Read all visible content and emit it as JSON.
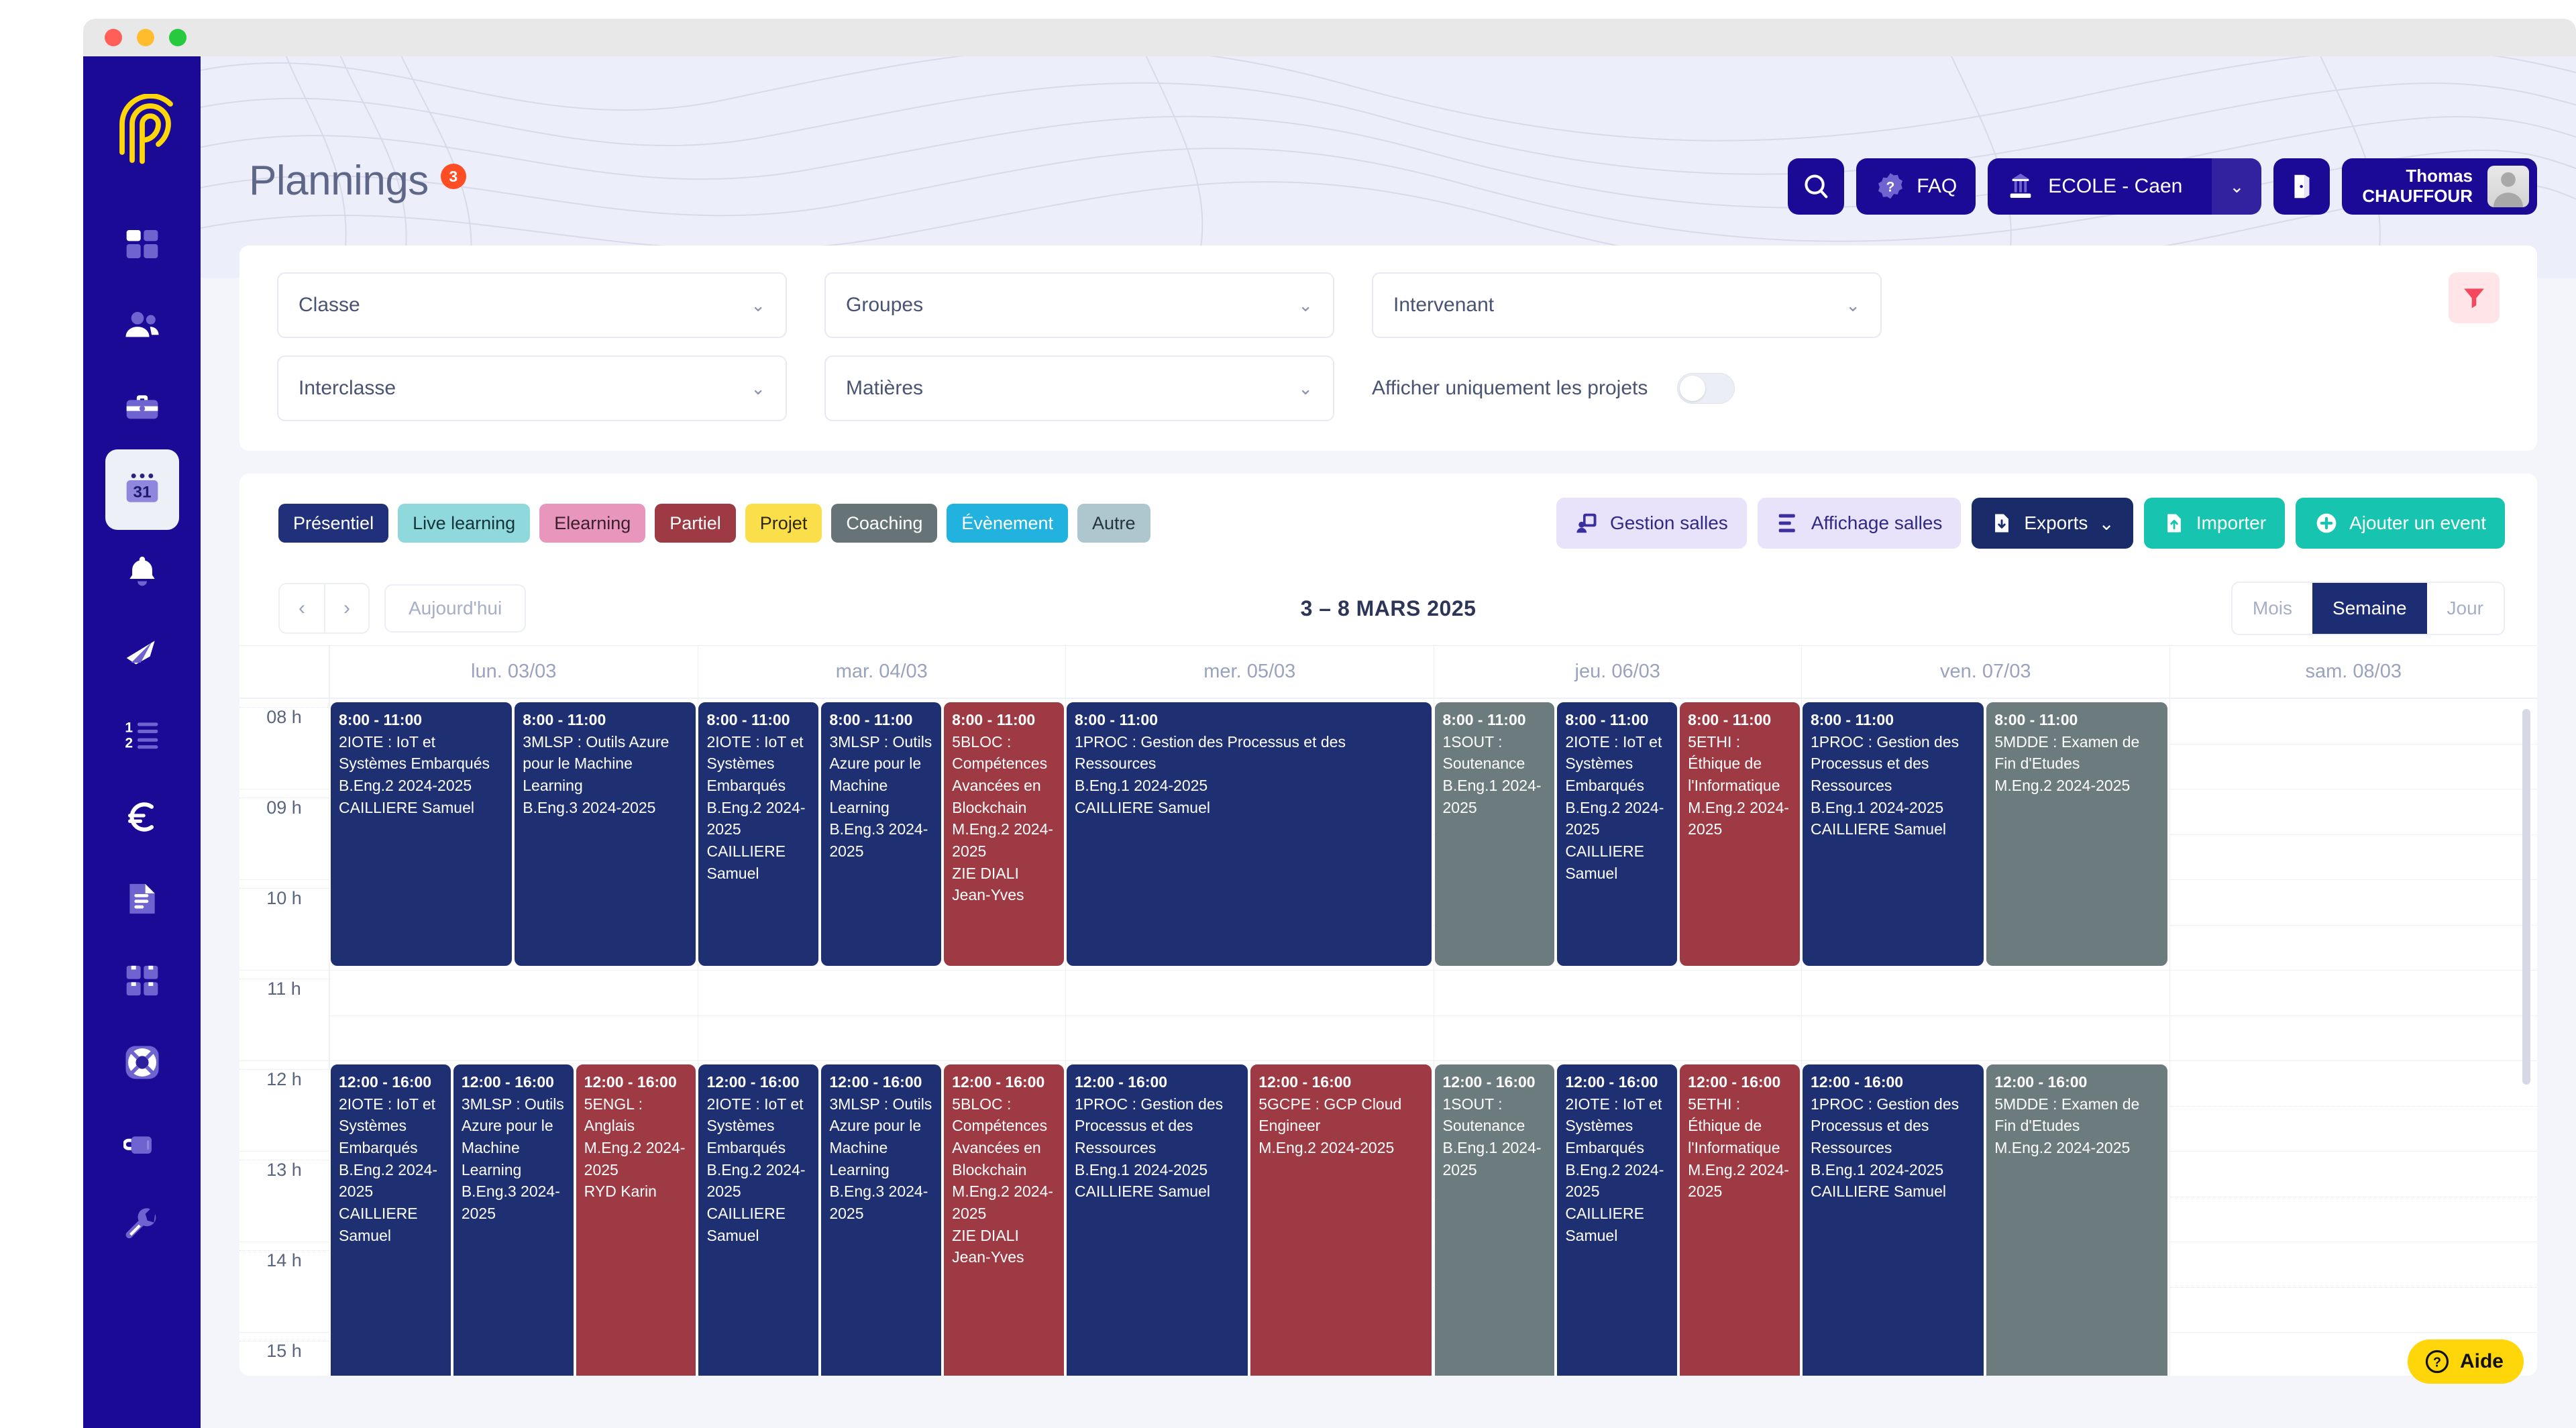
{
  "window": {
    "dots": [
      "close",
      "minimize",
      "maximize"
    ]
  },
  "sidebar": {
    "logo_name": "company-logo",
    "items": [
      {
        "name": "dashboard",
        "icon": "grid-icon",
        "active": false
      },
      {
        "name": "students",
        "icon": "users-icon",
        "active": false
      },
      {
        "name": "companies",
        "icon": "briefcase-icon",
        "active": false
      },
      {
        "name": "plannings",
        "icon": "calendar-31-icon",
        "active": true
      },
      {
        "name": "notifications",
        "icon": "bell-icon",
        "active": false
      },
      {
        "name": "campaigns",
        "icon": "rocket-icon",
        "active": false
      },
      {
        "name": "ranking",
        "icon": "ordered-list-icon",
        "active": false
      },
      {
        "name": "finance",
        "icon": "euro-icon",
        "active": false
      },
      {
        "name": "documents",
        "icon": "document-icon",
        "active": false
      },
      {
        "name": "modules",
        "icon": "boxes-icon",
        "active": false
      },
      {
        "name": "support",
        "icon": "lifebuoy-icon",
        "active": false
      },
      {
        "name": "coffee",
        "icon": "mug-icon",
        "active": false
      },
      {
        "name": "settings",
        "icon": "wrench-icon",
        "active": false
      }
    ]
  },
  "header": {
    "title": "Plannings",
    "badge": "3",
    "search_icon": "search-icon",
    "faq_label": "FAQ",
    "school_label": "ECOLE - Caen",
    "school_caret": "⌄",
    "logout_icon": "logout-icon",
    "user_first_name": "Thomas",
    "user_last_name": "CHAUFFOUR"
  },
  "filters": {
    "classe": "Classe",
    "groupes": "Groupes",
    "intervenant": "Intervenant",
    "interclasse": "Interclasse",
    "matieres": "Matières",
    "projects_toggle_label": "Afficher uniquement les projets",
    "projects_toggle_on": false,
    "filter_button": "filter-icon"
  },
  "legend": [
    {
      "label": "Présentiel",
      "bg": "#21307b",
      "fg": "#ffffff"
    },
    {
      "label": "Live learning",
      "bg": "#8fd9dd",
      "fg": "#15333a"
    },
    {
      "label": "Elearning",
      "bg": "#e996bd",
      "fg": "#3a1f2c"
    },
    {
      "label": "Partiel",
      "bg": "#9d3a44",
      "fg": "#ffffff"
    },
    {
      "label": "Projet",
      "bg": "#fbdf4a",
      "fg": "#2c2700"
    },
    {
      "label": "Coaching",
      "bg": "#667377",
      "fg": "#ffffff"
    },
    {
      "label": "Évènement",
      "bg": "#22b2e0",
      "fg": "#ffffff"
    },
    {
      "label": "Autre",
      "bg": "#aec7cf",
      "fg": "#23343a"
    }
  ],
  "actions": {
    "gestion_salles": "Gestion salles",
    "affichage_salles": "Affichage salles",
    "exports": "Exports",
    "exports_caret": "⌄",
    "importer": "Importer",
    "ajouter": "Ajouter un event"
  },
  "calendar": {
    "prev": "‹",
    "next": "›",
    "today": "Aujourd'hui",
    "range": "3 – 8 MARS 2025",
    "views": [
      {
        "label": "Mois",
        "active": false
      },
      {
        "label": "Semaine",
        "active": true
      },
      {
        "label": "Jour",
        "active": false
      }
    ],
    "days": [
      "lun. 03/03",
      "mar. 04/03",
      "mer. 05/03",
      "jeu. 06/03",
      "ven. 07/03",
      "sam. 08/03"
    ],
    "hours": [
      "08 h",
      "09 h",
      "10 h",
      "11 h",
      "12 h",
      "13 h",
      "14 h",
      "15 h"
    ],
    "events": [
      {
        "day": 0,
        "lane": 0,
        "lanes": 2,
        "start": 8,
        "end": 11,
        "color": "ev-navy",
        "time": "8:00 - 11:00",
        "title": "2IOTE : IoT et Systèmes Embarqués",
        "meta1": "B.Eng.2 2024-2025",
        "meta2": "CAILLIERE Samuel"
      },
      {
        "day": 0,
        "lane": 1,
        "lanes": 2,
        "start": 8,
        "end": 11,
        "color": "ev-navy",
        "time": "8:00 - 11:00",
        "title": "3MLSP : Outils Azure pour le Machine Learning",
        "meta1": "B.Eng.3 2024-2025",
        "meta2": ""
      },
      {
        "day": 1,
        "lane": 0,
        "lanes": 3,
        "start": 8,
        "end": 11,
        "color": "ev-navy",
        "time": "8:00 - 11:00",
        "title": "2IOTE : IoT et Systèmes Embarqués",
        "meta1": "B.Eng.2 2024-2025",
        "meta2": "CAILLIERE Samuel"
      },
      {
        "day": 1,
        "lane": 1,
        "lanes": 3,
        "start": 8,
        "end": 11,
        "color": "ev-navy",
        "time": "8:00 - 11:00",
        "title": "3MLSP : Outils Azure pour le Machine Learning",
        "meta1": "B.Eng.3 2024-2025",
        "meta2": ""
      },
      {
        "day": 1,
        "lane": 2,
        "lanes": 3,
        "start": 8,
        "end": 11,
        "color": "ev-red",
        "time": "8:00 - 11:00",
        "title": "5BLOC : Compétences Avancées en Blockchain",
        "meta1": "M.Eng.2 2024-2025",
        "meta2": "ZIE DIALI Jean-Yves"
      },
      {
        "day": 2,
        "lane": 0,
        "lanes": 1,
        "start": 8,
        "end": 11,
        "color": "ev-navy",
        "time": "8:00 - 11:00",
        "title": "1PROC : Gestion des Processus et des Ressources",
        "meta1": "B.Eng.1 2024-2025",
        "meta2": "CAILLIERE Samuel"
      },
      {
        "day": 3,
        "lane": 0,
        "lanes": 3,
        "start": 8,
        "end": 11,
        "color": "ev-grey",
        "time": "8:00 - 11:00",
        "title": "1SOUT : Soutenance",
        "meta1": "B.Eng.1 2024-2025",
        "meta2": ""
      },
      {
        "day": 3,
        "lane": 1,
        "lanes": 3,
        "start": 8,
        "end": 11,
        "color": "ev-navy",
        "time": "8:00 - 11:00",
        "title": "2IOTE : IoT et Systèmes Embarqués",
        "meta1": "B.Eng.2 2024-2025",
        "meta2": "CAILLIERE Samuel"
      },
      {
        "day": 3,
        "lane": 2,
        "lanes": 3,
        "start": 8,
        "end": 11,
        "color": "ev-red",
        "time": "8:00 - 11:00",
        "title": "5ETHI : Éthique de l'Informatique",
        "meta1": "M.Eng.2 2024-2025",
        "meta2": ""
      },
      {
        "day": 4,
        "lane": 0,
        "lanes": 2,
        "start": 8,
        "end": 11,
        "color": "ev-navy",
        "time": "8:00 - 11:00",
        "title": "1PROC : Gestion des Processus et des Ressources",
        "meta1": "B.Eng.1 2024-2025",
        "meta2": "CAILLIERE Samuel"
      },
      {
        "day": 4,
        "lane": 1,
        "lanes": 2,
        "start": 8,
        "end": 11,
        "color": "ev-grey",
        "time": "8:00 - 11:00",
        "title": "5MDDE : Examen de Fin d'Etudes",
        "meta1": "M.Eng.2 2024-2025",
        "meta2": ""
      },
      {
        "day": 0,
        "lane": 0,
        "lanes": 3,
        "start": 12,
        "end": 16,
        "color": "ev-navy",
        "time": "12:00 - 16:00",
        "title": "2IOTE : IoT et Systèmes Embarqués",
        "meta1": "B.Eng.2 2024-2025",
        "meta2": "CAILLIERE Samuel"
      },
      {
        "day": 0,
        "lane": 1,
        "lanes": 3,
        "start": 12,
        "end": 16,
        "color": "ev-navy",
        "time": "12:00 - 16:00",
        "title": "3MLSP : Outils Azure pour le Machine Learning",
        "meta1": "B.Eng.3 2024-2025",
        "meta2": ""
      },
      {
        "day": 0,
        "lane": 2,
        "lanes": 3,
        "start": 12,
        "end": 16,
        "color": "ev-red",
        "time": "12:00 - 16:00",
        "title": "5ENGL : Anglais",
        "meta1": "M.Eng.2 2024-2025",
        "meta2": "RYD Karin"
      },
      {
        "day": 1,
        "lane": 0,
        "lanes": 3,
        "start": 12,
        "end": 16,
        "color": "ev-navy",
        "time": "12:00 - 16:00",
        "title": "2IOTE : IoT et Systèmes Embarqués",
        "meta1": "B.Eng.2 2024-2025",
        "meta2": "CAILLIERE Samuel"
      },
      {
        "day": 1,
        "lane": 1,
        "lanes": 3,
        "start": 12,
        "end": 16,
        "color": "ev-navy",
        "time": "12:00 - 16:00",
        "title": "3MLSP : Outils Azure pour le Machine Learning",
        "meta1": "B.Eng.3 2024-2025",
        "meta2": ""
      },
      {
        "day": 1,
        "lane": 2,
        "lanes": 3,
        "start": 12,
        "end": 16,
        "color": "ev-red",
        "time": "12:00 - 16:00",
        "title": "5BLOC : Compétences Avancées en Blockchain",
        "meta1": "M.Eng.2 2024-2025",
        "meta2": "ZIE DIALI Jean-Yves"
      },
      {
        "day": 2,
        "lane": 0,
        "lanes": 2,
        "start": 12,
        "end": 16,
        "color": "ev-navy",
        "time": "12:00 - 16:00",
        "title": "1PROC : Gestion des Processus et des Ressources",
        "meta1": "B.Eng.1 2024-2025",
        "meta2": "CAILLIERE Samuel"
      },
      {
        "day": 2,
        "lane": 1,
        "lanes": 2,
        "start": 12,
        "end": 16,
        "color": "ev-red",
        "time": "12:00 - 16:00",
        "title": "5GCPE : GCP Cloud Engineer",
        "meta1": "M.Eng.2 2024-2025",
        "meta2": ""
      },
      {
        "day": 3,
        "lane": 0,
        "lanes": 3,
        "start": 12,
        "end": 16,
        "color": "ev-grey",
        "time": "12:00 - 16:00",
        "title": "1SOUT : Soutenance",
        "meta1": "B.Eng.1 2024-2025",
        "meta2": ""
      },
      {
        "day": 3,
        "lane": 1,
        "lanes": 3,
        "start": 12,
        "end": 16,
        "color": "ev-navy",
        "time": "12:00 - 16:00",
        "title": "2IOTE : IoT et Systèmes Embarqués",
        "meta1": "B.Eng.2 2024-2025",
        "meta2": "CAILLIERE Samuel"
      },
      {
        "day": 3,
        "lane": 2,
        "lanes": 3,
        "start": 12,
        "end": 16,
        "color": "ev-red",
        "time": "12:00 - 16:00",
        "title": "5ETHI : Éthique de l'Informatique",
        "meta1": "M.Eng.2 2024-2025",
        "meta2": ""
      },
      {
        "day": 4,
        "lane": 0,
        "lanes": 2,
        "start": 12,
        "end": 16,
        "color": "ev-navy",
        "time": "12:00 - 16:00",
        "title": "1PROC : Gestion des Processus et des Ressources",
        "meta1": "B.Eng.1 2024-2025",
        "meta2": "CAILLIERE Samuel"
      },
      {
        "day": 4,
        "lane": 1,
        "lanes": 2,
        "start": 12,
        "end": 16,
        "color": "ev-grey",
        "time": "12:00 - 16:00",
        "title": "5MDDE : Examen de Fin d'Etudes",
        "meta1": "M.Eng.2 2024-2025",
        "meta2": ""
      }
    ]
  },
  "help": {
    "label": "Aide",
    "icon": "question-circle-icon"
  }
}
